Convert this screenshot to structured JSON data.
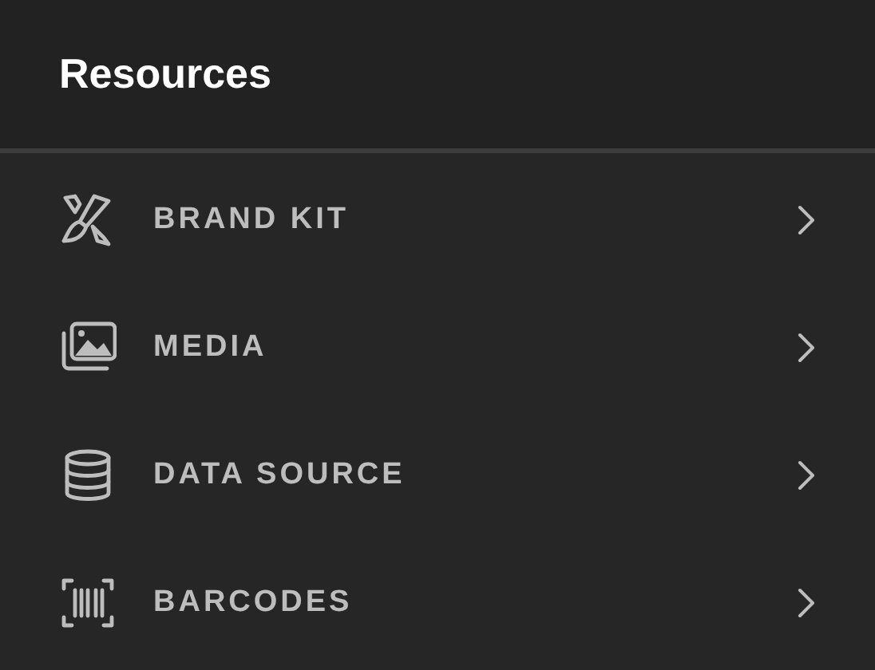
{
  "panel": {
    "title": "Resources"
  },
  "items": [
    {
      "label": "BRAND KIT"
    },
    {
      "label": "MEDIA"
    },
    {
      "label": "DATA SOURCE"
    },
    {
      "label": "BARCODES"
    }
  ]
}
